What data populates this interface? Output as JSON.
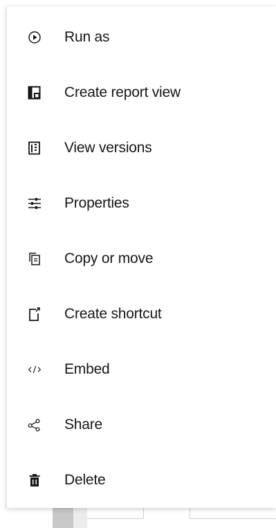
{
  "menu": {
    "items": [
      {
        "label": "Run as",
        "icon": "play-circle-icon"
      },
      {
        "label": "Create report view",
        "icon": "report-view-icon"
      },
      {
        "label": "View versions",
        "icon": "versions-icon"
      },
      {
        "label": "Properties",
        "icon": "sliders-icon"
      },
      {
        "label": "Copy or move",
        "icon": "copy-icon"
      },
      {
        "label": "Create shortcut",
        "icon": "shortcut-icon"
      },
      {
        "label": "Embed",
        "icon": "code-icon"
      },
      {
        "label": "Share",
        "icon": "share-icon"
      },
      {
        "label": "Delete",
        "icon": "trash-icon"
      }
    ]
  },
  "colors": {
    "text": "#161616",
    "icon": "#161616",
    "background": "#ffffff"
  }
}
